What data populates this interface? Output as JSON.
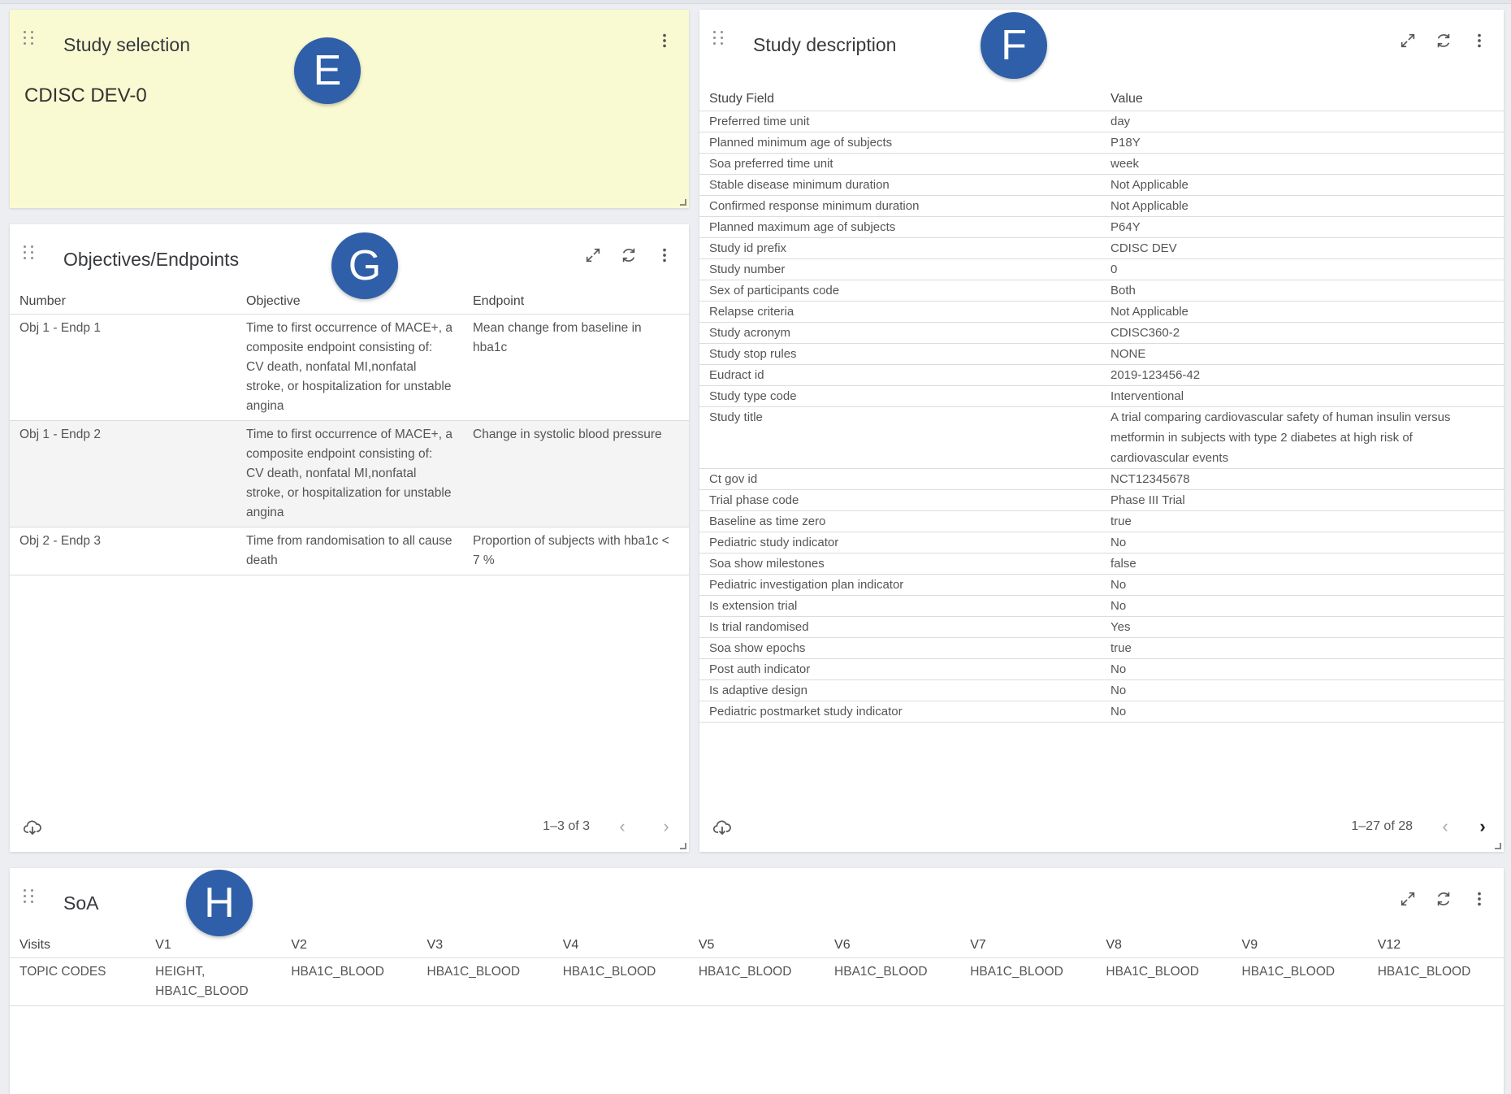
{
  "study_selection": {
    "title": "Study selection",
    "value": "CDISC DEV-0",
    "badge": "E"
  },
  "study_description": {
    "title": "Study description",
    "badge": "F",
    "columns": [
      "Study Field",
      "Value"
    ],
    "rows": [
      [
        "Preferred time unit",
        "day"
      ],
      [
        "Planned minimum age of subjects",
        "P18Y"
      ],
      [
        "Soa preferred time unit",
        "week"
      ],
      [
        "Stable disease minimum duration",
        "Not Applicable"
      ],
      [
        "Confirmed response minimum duration",
        "Not Applicable"
      ],
      [
        "Planned maximum age of subjects",
        "P64Y"
      ],
      [
        "Study id prefix",
        "CDISC DEV"
      ],
      [
        "Study number",
        "0"
      ],
      [
        "Sex of participants code",
        "Both"
      ],
      [
        "Relapse criteria",
        "Not Applicable"
      ],
      [
        "Study acronym",
        "CDISC360-2"
      ],
      [
        "Study stop rules",
        "NONE"
      ],
      [
        "Eudract id",
        "2019-123456-42"
      ],
      [
        "Study type code",
        "Interventional"
      ],
      [
        "Study title",
        "A trial comparing cardiovascular safety of human insulin versus metformin in subjects with type 2 diabetes at high risk of cardiovascular events"
      ],
      [
        "Ct gov id",
        "NCT12345678"
      ],
      [
        "Trial phase code",
        "Phase III Trial"
      ],
      [
        "Baseline as time zero",
        "true"
      ],
      [
        "Pediatric study indicator",
        "No"
      ],
      [
        "Soa show milestones",
        "false"
      ],
      [
        "Pediatric investigation plan indicator",
        "No"
      ],
      [
        "Is extension trial",
        "No"
      ],
      [
        "Is trial randomised",
        "Yes"
      ],
      [
        "Soa show epochs",
        "true"
      ],
      [
        "Post auth indicator",
        "No"
      ],
      [
        "Is adaptive design",
        "No"
      ],
      [
        "Pediatric postmarket study indicator",
        "No"
      ]
    ],
    "pagination": "1–27 of 28"
  },
  "objectives": {
    "title": "Objectives/Endpoints",
    "badge": "G",
    "columns": [
      "Number",
      "Objective",
      "Endpoint"
    ],
    "rows": [
      [
        "Obj 1 - Endp 1",
        "Time to first occurrence of MACE+, a composite endpoint consisting of: CV death, nonfatal MI,nonfatal stroke, or hospitalization for unstable angina",
        "Mean change from baseline in hba1c"
      ],
      [
        "Obj 1 - Endp 2",
        "Time to first occurrence of MACE+, a composite endpoint consisting of: CV death, nonfatal MI,nonfatal stroke, or hospitalization for unstable angina",
        "Change in systolic blood pressure"
      ],
      [
        "Obj 2 - Endp 3",
        "Time from randomisation to all cause death",
        "Proportion of subjects with hba1c < 7 %"
      ]
    ],
    "pagination": "1–3 of 3"
  },
  "soa": {
    "title": "SoA",
    "badge": "H",
    "columns": [
      "Visits",
      "V1",
      "V2",
      "V3",
      "V4",
      "V5",
      "V6",
      "V7",
      "V8",
      "V9",
      "V12"
    ],
    "rows": [
      [
        "TOPIC CODES",
        "HEIGHT, HBA1C_BLOOD",
        "HBA1C_BLOOD",
        "HBA1C_BLOOD",
        "HBA1C_BLOOD",
        "HBA1C_BLOOD",
        "HBA1C_BLOOD",
        "HBA1C_BLOOD",
        "HBA1C_BLOOD",
        "HBA1C_BLOOD",
        "HBA1C_BLOOD"
      ]
    ]
  },
  "icons": [
    "drag-handle-icon",
    "expand-icon",
    "refresh-icon",
    "more-vert-icon",
    "download-icon",
    "chevron-left-icon",
    "chevron-right-icon"
  ]
}
